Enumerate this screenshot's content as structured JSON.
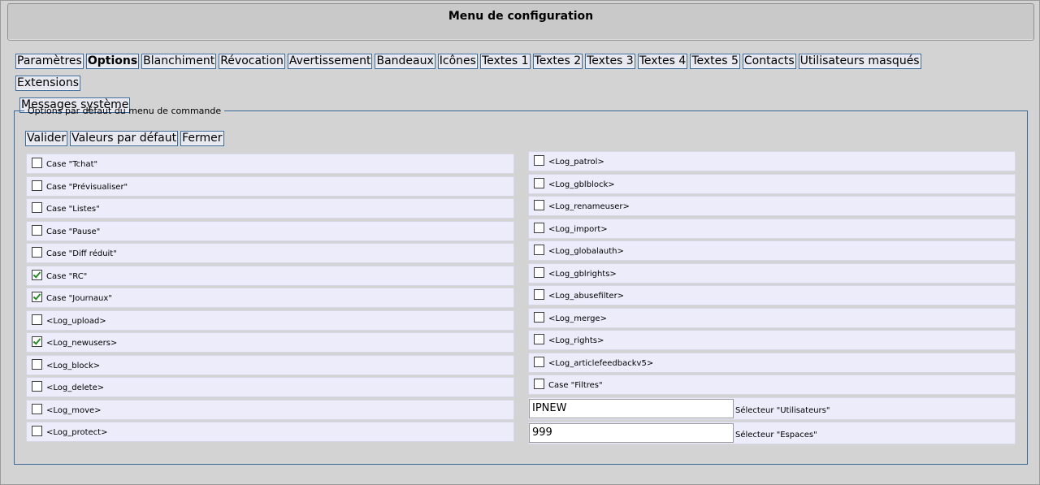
{
  "window": {
    "title": "Menu de configuration"
  },
  "tabs_row1": [
    "Paramètres",
    "Options",
    "Blanchiment",
    "Révocation",
    "Avertissement",
    "Bandeaux",
    "Icônes",
    "Textes 1",
    "Textes 2",
    "Textes 3",
    "Textes 4",
    "Textes 5",
    "Contacts",
    "Utilisateurs masqués",
    "Extensions"
  ],
  "tabs_row2": [
    "Messages système"
  ],
  "active_tab": "Options",
  "section": {
    "legend": "Options par défaut du menu de commande",
    "buttons": {
      "validate": "Valider",
      "defaults": "Valeurs par défaut",
      "close": "Fermer"
    }
  },
  "left_options": [
    {
      "label": "Case \"Tchat\"",
      "checked": false
    },
    {
      "label": "Case \"Prévisualiser\"",
      "checked": false
    },
    {
      "label": "Case \"Listes\"",
      "checked": false
    },
    {
      "label": "Case \"Pause\"",
      "checked": false
    },
    {
      "label": "Case \"Diff réduit\"",
      "checked": false
    },
    {
      "label": "Case \"RC\"",
      "checked": true
    },
    {
      "label": "Case \"Journaux\"",
      "checked": true
    },
    {
      "label": "<Log_upload>",
      "checked": false
    },
    {
      "label": "<Log_newusers>",
      "checked": true
    },
    {
      "label": "<Log_block>",
      "checked": false
    },
    {
      "label": "<Log_delete>",
      "checked": false
    },
    {
      "label": "<Log_move>",
      "checked": false
    },
    {
      "label": "<Log_protect>",
      "checked": false
    }
  ],
  "right_options": [
    {
      "label": "<Log_patrol>",
      "checked": false
    },
    {
      "label": "<Log_gblblock>",
      "checked": false
    },
    {
      "label": "<Log_renameuser>",
      "checked": false
    },
    {
      "label": "<Log_import>",
      "checked": false
    },
    {
      "label": "<Log_globalauth>",
      "checked": false
    },
    {
      "label": "<Log_gblrights>",
      "checked": false
    },
    {
      "label": "<Log_abusefilter>",
      "checked": false
    },
    {
      "label": "<Log_merge>",
      "checked": false
    },
    {
      "label": "<Log_rights>",
      "checked": false
    },
    {
      "label": "<Log_articlefeedbackv5>",
      "checked": false
    },
    {
      "label": "Case \"Filtres\"",
      "checked": false
    }
  ],
  "selectors": [
    {
      "value": "IPNEW",
      "label": "Sélecteur \"Utilisateurs\""
    },
    {
      "value": "999",
      "label": "Sélecteur \"Espaces\""
    }
  ],
  "colors": {
    "border_accent": "#3b6a9a",
    "row_bg": "#ececfa",
    "check": "#2a8a2a"
  }
}
